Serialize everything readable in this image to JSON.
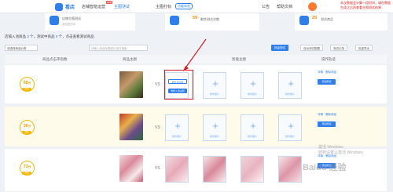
{
  "topbar": {
    "logo_text": "看店",
    "nav": [
      "店铺智能运营",
      "主图测试",
      "主图打标"
    ],
    "new_badge": "new",
    "pill_tag": "功能体验",
    "right": [
      "公告",
      "帮助文档"
    ],
    "red_note": "本次数据会计算一段时间，请在数据生成之后再查看主图测试结果"
  },
  "cards": [
    {
      "title": "店铺主图测试",
      "sub": "测试进行中",
      "value": ""
    },
    {
      "title": "剩余测试次数",
      "sub": "",
      "value": "59"
    },
    {
      "title": "测试商品",
      "sub": "",
      "value": "25"
    }
  ],
  "summary": {
    "prefix": "店铺入池商品",
    "count1": "3",
    "mid": "个，测试中商品",
    "count2": "0",
    "suffix": "个，点击查看测试商品"
  },
  "filter": {
    "select_value": "请选择商品分类",
    "search_placeholder": "请输入商品标题或ID进行搜索",
    "buttons": [
      "批量测试",
      "自动测试配置",
      "测试记录",
      "批量导出"
    ]
  },
  "table": {
    "headers": [
      "商品点击率指数",
      "商品主图",
      "智能主图",
      "操作轨迹"
    ],
    "rows": [
      {
        "score": "68",
        "tag": "较低",
        "vs": "VS",
        "btn_outline": "制作白底图",
        "btn_fill": "制作入选主图",
        "slot_label": "制作图片",
        "links": "详情 · 删除商品",
        "op_btn": "添加测试"
      },
      {
        "score": "36",
        "tag": "较低",
        "vs": "VS",
        "slot_label": "制作图片",
        "links": "详情 · 删除商品",
        "op_btn": "添加测试"
      },
      {
        "score": "73",
        "tag": "较低",
        "vs": "VS",
        "slot_label": "制作图片",
        "links": "详情 · 删除商品",
        "op_btn": "添加测试"
      }
    ]
  },
  "watermark": "Baidu 经验",
  "windows_note": [
    "激活 Windows",
    "转到设置以激活 Windows"
  ],
  "colors": {
    "accent": "#2d7ff0",
    "highlight_border": "#e0161e",
    "score_ring": "#f5b800"
  }
}
